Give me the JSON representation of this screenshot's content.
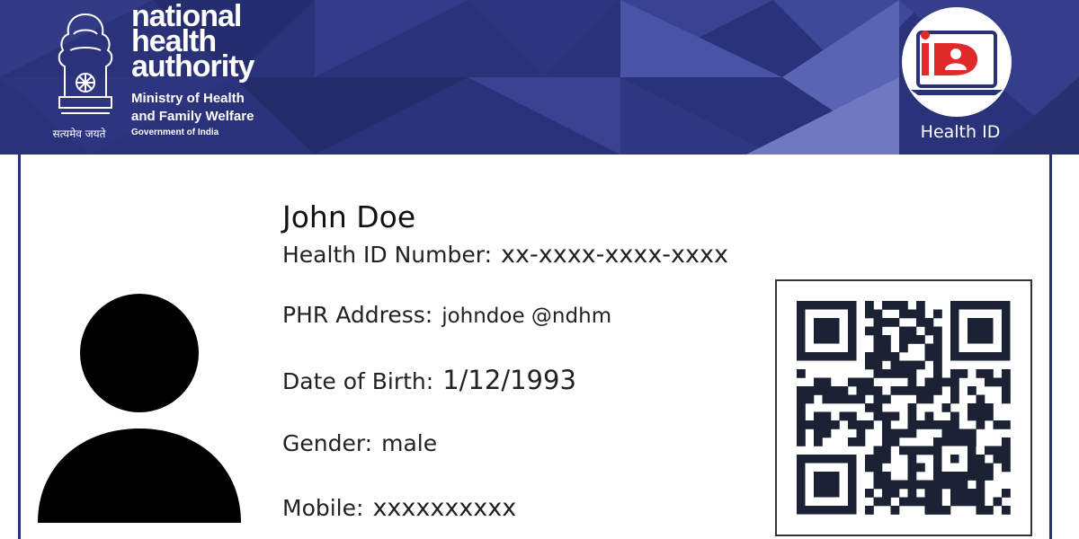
{
  "header": {
    "org_lines": [
      "national",
      "health",
      "authority"
    ],
    "ministry_lines": [
      "Ministry of Health",
      "and Family Welfare"
    ],
    "government": "Government of India",
    "emblem_motto": "सत्यमेव जयते",
    "health_id_label": "Health ID",
    "logo_icon": "health-id-logo-icon",
    "emblem_icon": "national-emblem-icon"
  },
  "card": {
    "name": "John Doe",
    "fields": [
      {
        "label": "Health ID Number:",
        "value": "xx-xxxx-xxxx-xxxx"
      },
      {
        "label": "PHR Address:",
        "value": "johndoe @ndhm"
      },
      {
        "label": "Date of Birth:",
        "value": "1/12/1993"
      },
      {
        "label": "Gender:",
        "value": "male"
      },
      {
        "label": "Mobile:",
        "value": "xxxxxxxxxx"
      }
    ],
    "avatar_icon": "person-silhouette-icon",
    "qr_icon": "qr-code-icon"
  },
  "colors": {
    "header_bg": "#2a3279",
    "accent_red": "#e02b2b",
    "text_dark": "#222222"
  }
}
